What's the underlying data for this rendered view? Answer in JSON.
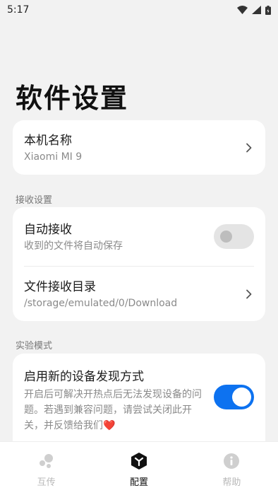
{
  "status_bar": {
    "time": "5:17"
  },
  "page": {
    "title": "软件设置"
  },
  "device_card": {
    "title": "本机名称",
    "value": "Xiaomi MI 9"
  },
  "receive_section": {
    "label": "接收设置",
    "auto_receive": {
      "title": "自动接收",
      "subtitle": "收到的文件将自动保存",
      "enabled": false
    },
    "receive_dir": {
      "title": "文件接收目录",
      "value": "/storage/emulated/0/Download"
    }
  },
  "experimental_section": {
    "label": "实验模式",
    "new_discovery": {
      "title": "启用新的设备发现方式",
      "description": "开启后可解决开热点后无法发现设备的问题。若遇到兼容问题，请尝试关闭此开关，并反馈给我们❤️",
      "enabled": true
    }
  },
  "bottom_nav": {
    "items": [
      {
        "label": "互传",
        "icon": "transfer-icon",
        "active": false
      },
      {
        "label": "配置",
        "icon": "settings-cube-icon",
        "active": true
      },
      {
        "label": "帮助",
        "icon": "info-icon",
        "active": false
      }
    ]
  },
  "colors": {
    "accent": "#0d72f0",
    "background": "#f2f2f2",
    "card": "#ffffff"
  }
}
